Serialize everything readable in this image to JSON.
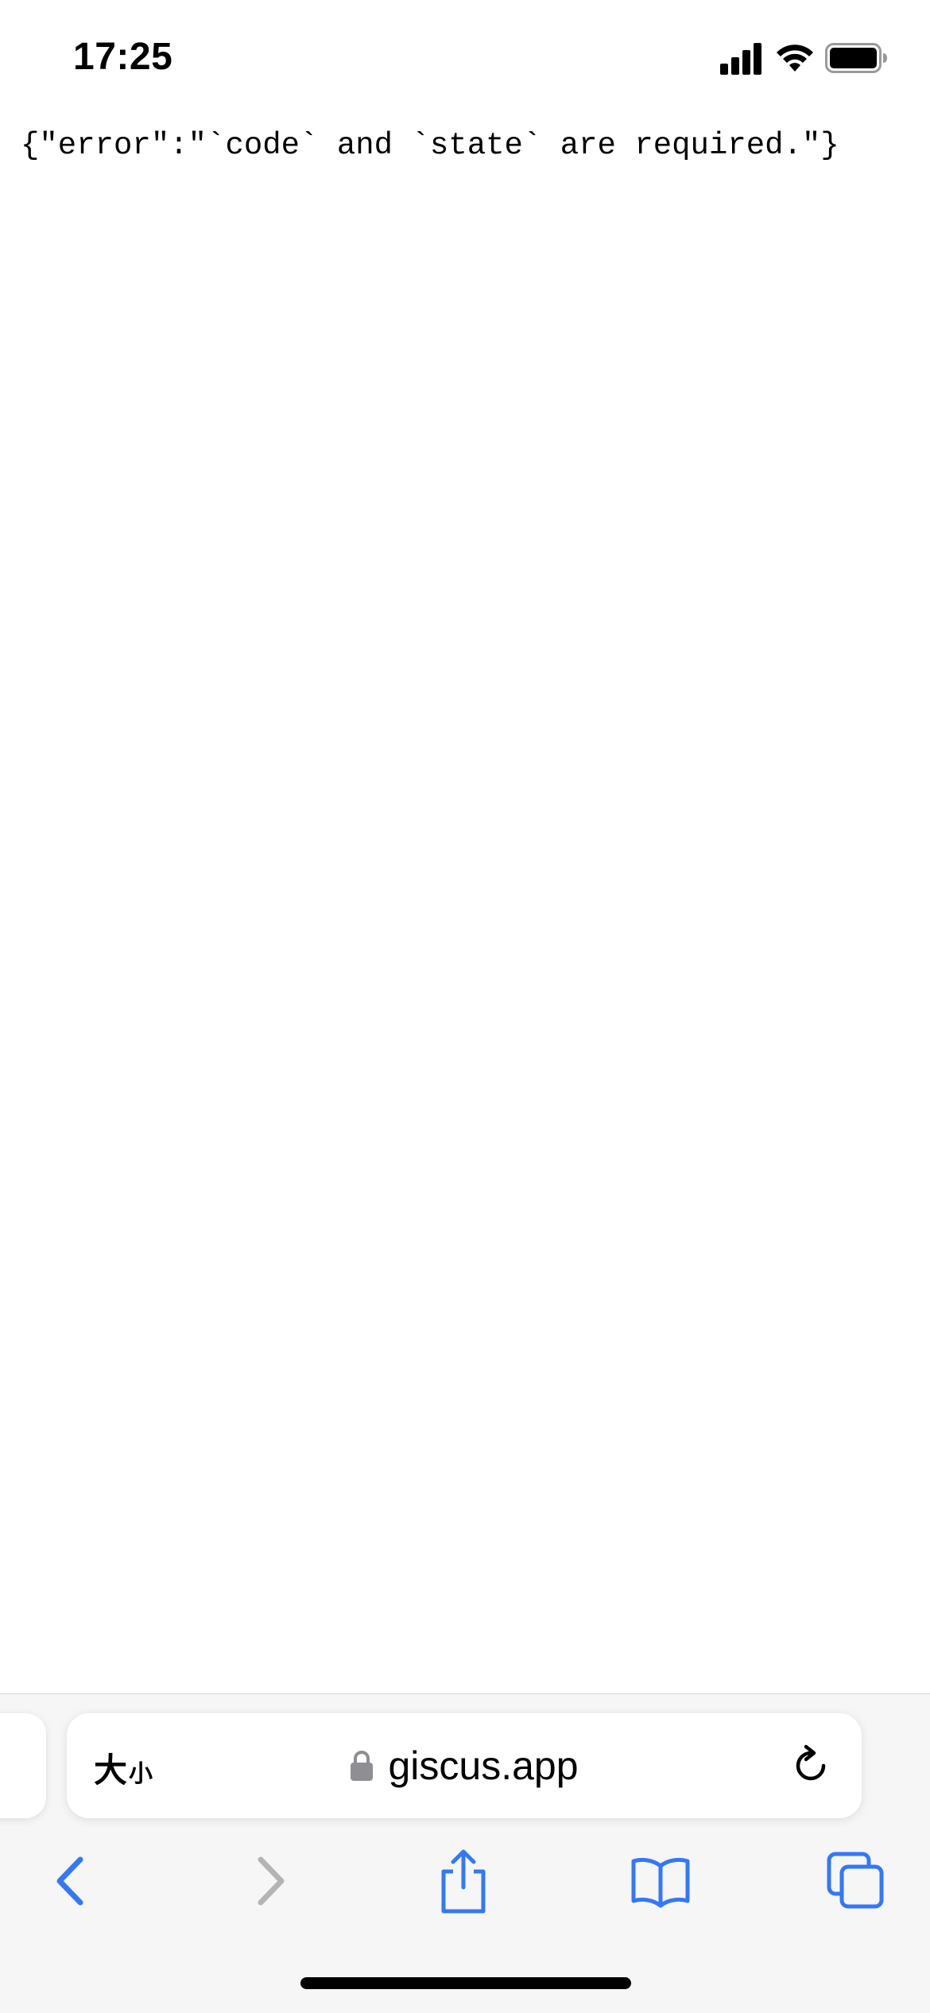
{
  "status_bar": {
    "time": "17:25",
    "signal_icon": "cellular-signal-icon",
    "wifi_icon": "wifi-icon",
    "battery_icon": "battery-icon"
  },
  "page": {
    "body_text": "{\"error\":\"`code` and `state` are required.\"}"
  },
  "address_bar": {
    "text_size_label_big": "大",
    "text_size_label_small": "小",
    "lock_icon": "lock-icon",
    "url": "giscus.app",
    "reload_icon": "reload-icon"
  },
  "toolbar": {
    "back_icon": "chevron-left-icon",
    "forward_icon": "chevron-right-icon",
    "share_icon": "share-icon",
    "bookmarks_icon": "book-icon",
    "tabs_icon": "tabs-icon"
  },
  "colors": {
    "accent": "#3478f6",
    "disabled": "#b4b4b4",
    "toolbar_bg": "#f6f6f6"
  }
}
